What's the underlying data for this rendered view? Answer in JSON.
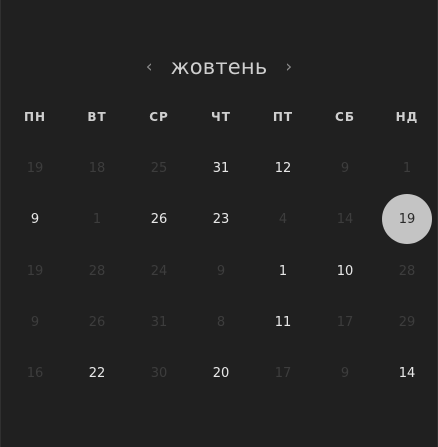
{
  "header": {
    "month": "жовтень",
    "prev_icon": "‹",
    "next_icon": "›"
  },
  "weekdays": [
    "ПН",
    "ВТ",
    "СР",
    "ЧТ",
    "ПТ",
    "СБ",
    "НД"
  ],
  "colors": {
    "background": "#202020",
    "active_day": "#e8e8e8",
    "muted_day": "#3d3d3d",
    "selected_bg": "#c4c4c4",
    "selected_text": "#2a2a2a"
  },
  "weeks": [
    [
      {
        "d": "19",
        "s": "out"
      },
      {
        "d": "18",
        "s": "out"
      },
      {
        "d": "25",
        "s": "out"
      },
      {
        "d": "31",
        "s": "in"
      },
      {
        "d": "12",
        "s": "in"
      },
      {
        "d": "9",
        "s": "out"
      },
      {
        "d": "1",
        "s": "out"
      }
    ],
    [
      {
        "d": "9",
        "s": "in"
      },
      {
        "d": "1",
        "s": "out"
      },
      {
        "d": "26",
        "s": "in"
      },
      {
        "d": "23",
        "s": "in"
      },
      {
        "d": "4",
        "s": "out"
      },
      {
        "d": "14",
        "s": "out"
      },
      {
        "d": "19",
        "s": "selected"
      }
    ],
    [
      {
        "d": "19",
        "s": "out"
      },
      {
        "d": "28",
        "s": "out"
      },
      {
        "d": "24",
        "s": "out"
      },
      {
        "d": "9",
        "s": "out"
      },
      {
        "d": "1",
        "s": "in"
      },
      {
        "d": "10",
        "s": "in"
      },
      {
        "d": "28",
        "s": "out"
      }
    ],
    [
      {
        "d": "9",
        "s": "out"
      },
      {
        "d": "26",
        "s": "out"
      },
      {
        "d": "31",
        "s": "out"
      },
      {
        "d": "8",
        "s": "out"
      },
      {
        "d": "11",
        "s": "in"
      },
      {
        "d": "17",
        "s": "out"
      },
      {
        "d": "29",
        "s": "out"
      }
    ],
    [
      {
        "d": "16",
        "s": "out"
      },
      {
        "d": "22",
        "s": "in"
      },
      {
        "d": "30",
        "s": "out"
      },
      {
        "d": "20",
        "s": "in"
      },
      {
        "d": "17",
        "s": "out"
      },
      {
        "d": "9",
        "s": "out"
      },
      {
        "d": "14",
        "s": "in"
      }
    ]
  ]
}
